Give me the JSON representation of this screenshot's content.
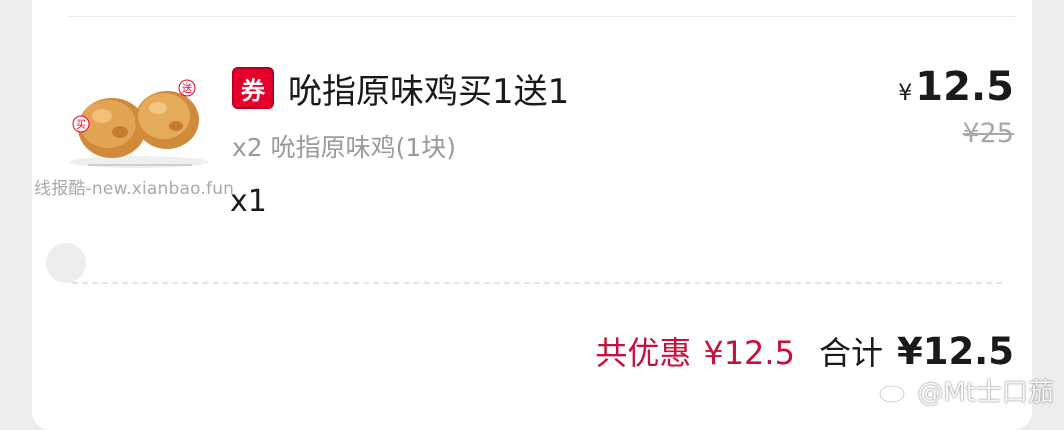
{
  "order_item": {
    "coupon_badge": "券",
    "title": "吮指原味鸡买1送1",
    "subtitle": "x2 吮指原味鸡(1块)",
    "quantity": "x1",
    "price_currency": "¥",
    "price": "12.5",
    "original_price": "¥25",
    "image_icon": "fried-chicken-image",
    "image_tags": {
      "buy": "买",
      "gift": "送"
    }
  },
  "summary": {
    "discount_label": "共优惠",
    "discount_value": "¥12.5",
    "total_label": "合计",
    "total_value": "¥12.5"
  },
  "watermarks": {
    "site": "线报酷-new.xianbao.fun",
    "weibo_handle": "@Mt士口茄",
    "weibo_icon": "weibo-icon"
  },
  "colors": {
    "background": "#ededed",
    "card": "#ffffff",
    "accent_red": "#e4002b",
    "discount_text": "#c8103e",
    "muted_text": "#9a9a9a"
  }
}
